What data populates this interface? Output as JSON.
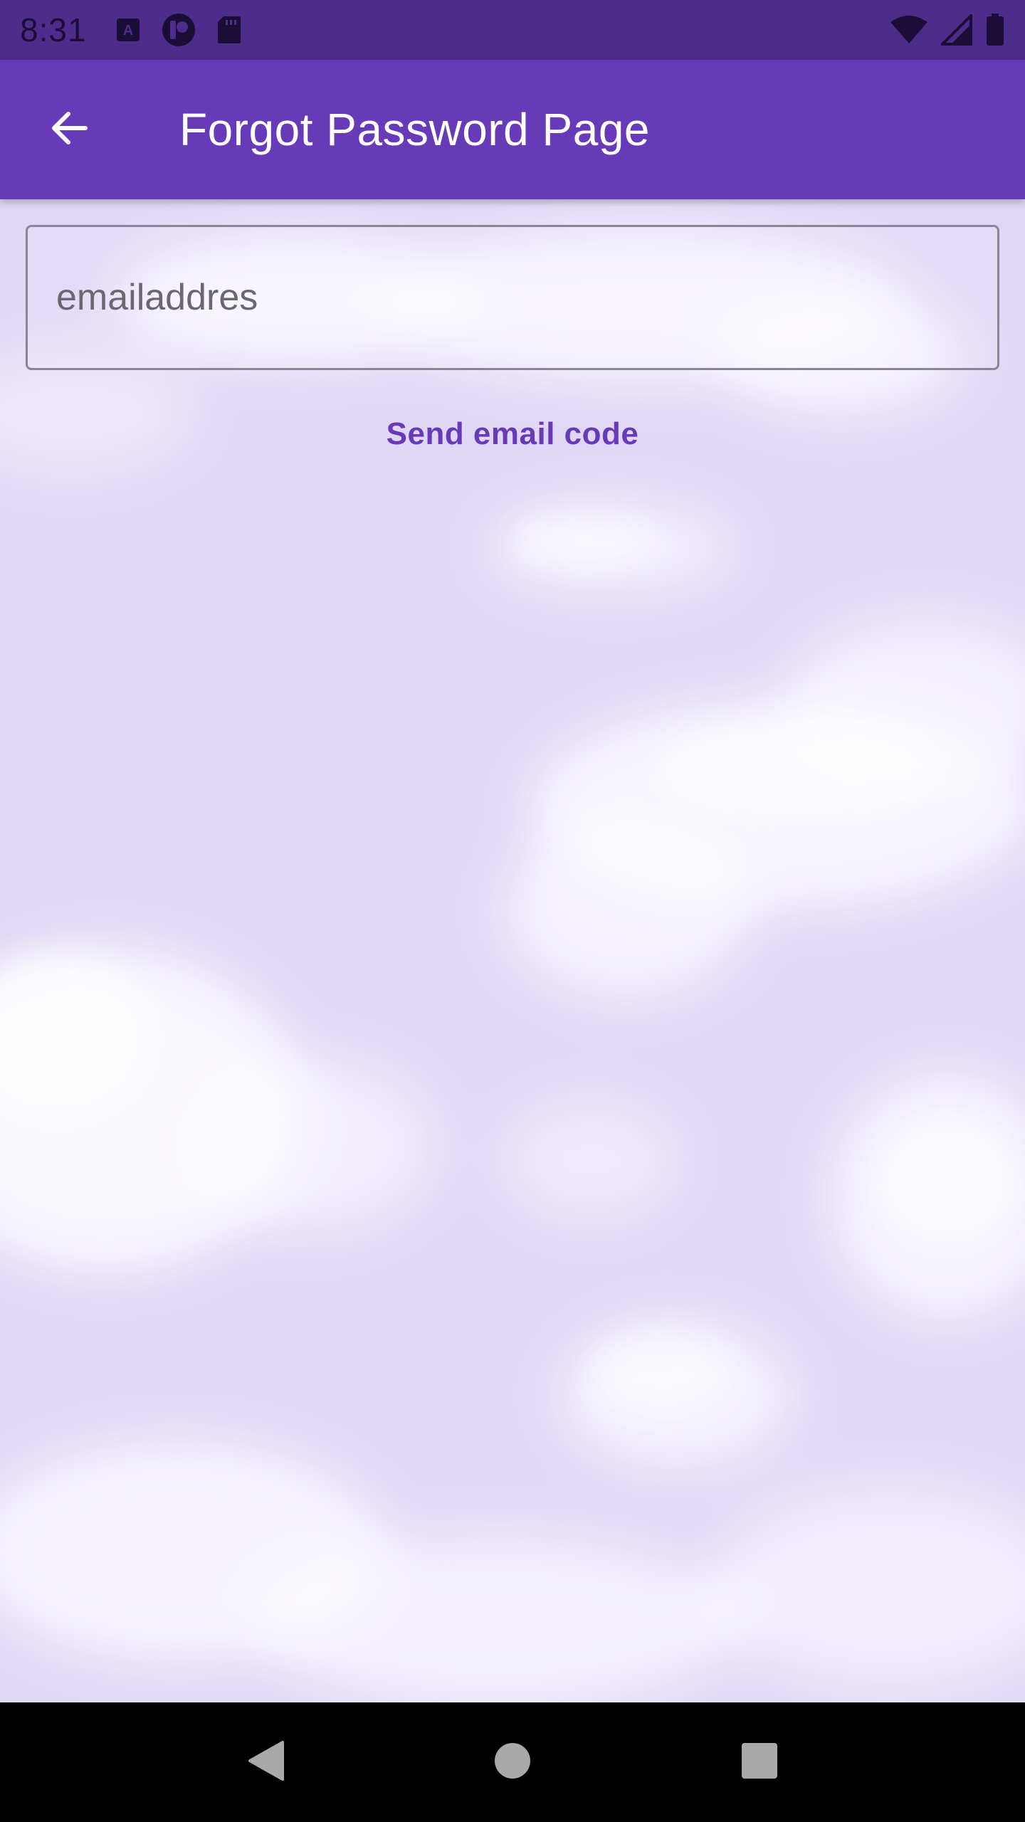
{
  "status_bar": {
    "time": "8:31",
    "left_icons": [
      "a-box-icon",
      "circle-app-icon",
      "sd-card-icon"
    ],
    "right_icons": [
      "wifi-icon",
      "signal-icon",
      "battery-icon"
    ]
  },
  "app_bar": {
    "title": "Forgot Password Page",
    "back_icon": "arrow-back-icon",
    "color": "#673ab7"
  },
  "form": {
    "email_value": "emailaddres",
    "send_code_label": "Send email code"
  },
  "nav_bar": {
    "buttons": [
      "back-triangle-icon",
      "home-circle-icon",
      "recents-square-icon"
    ]
  },
  "colors": {
    "status_bar": "#4e2c8c",
    "accent": "#673ab7",
    "background": "#e0d7f7"
  }
}
